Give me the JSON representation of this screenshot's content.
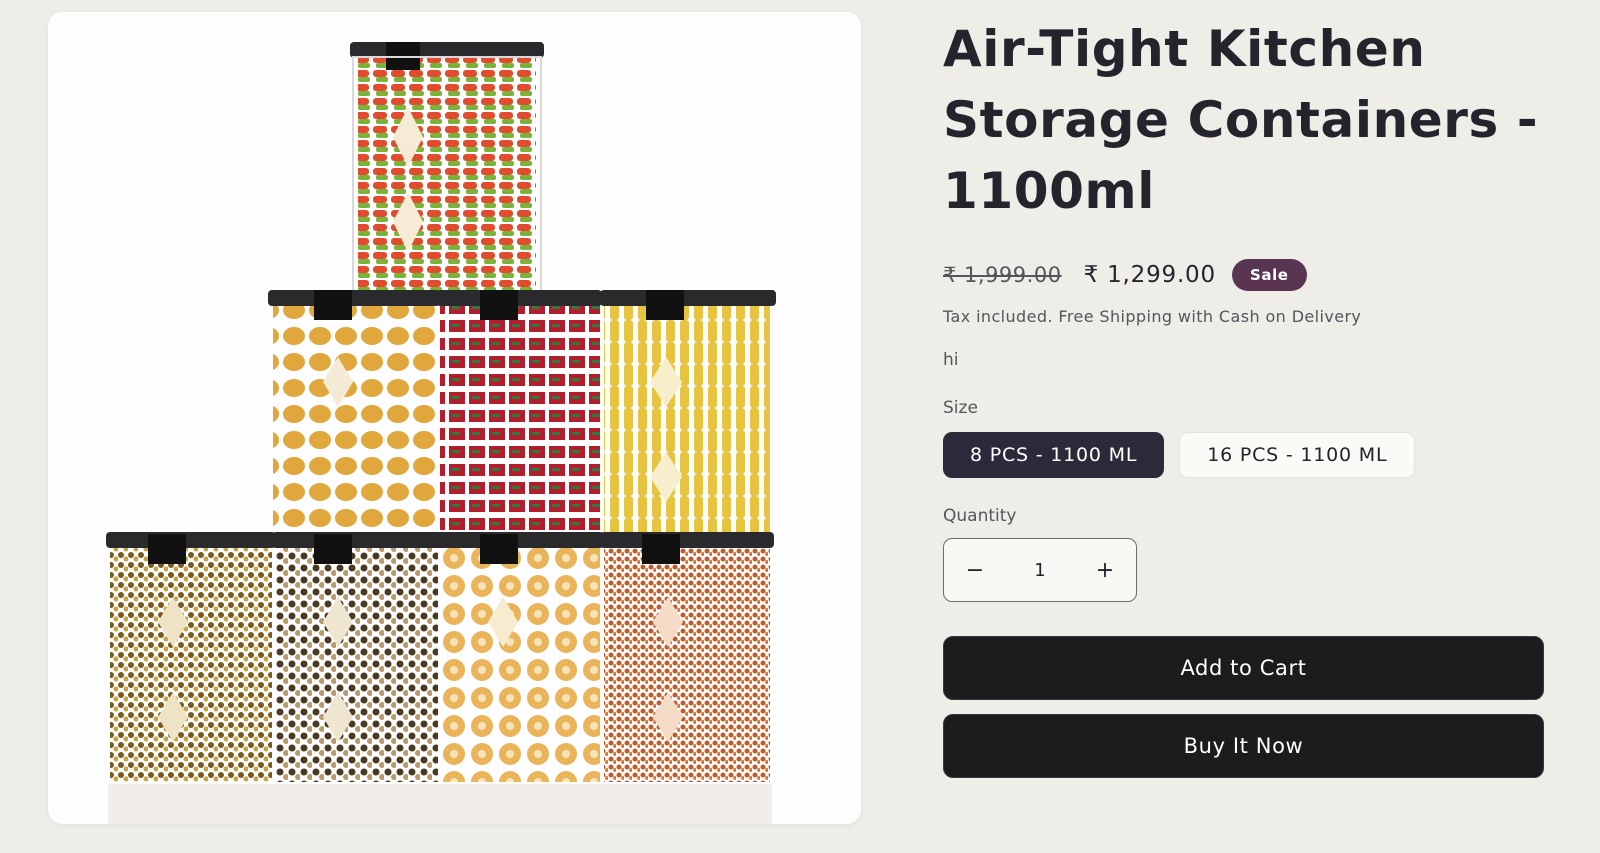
{
  "product": {
    "title": "Air-Tight Kitchen Storage Containers - 1100ml",
    "image_alt": "Stacked air-tight kitchen storage containers filled with pasta, chips, candies and pulses",
    "price_compare": "₹ 1,999.00",
    "price_sale": "₹ 1,299.00",
    "badge": "Sale",
    "tax_note": "Tax included. Free Shipping with Cash on Delivery",
    "description": "hi"
  },
  "variant": {
    "label": "Size",
    "options": [
      "8 PCS - 1100 ML",
      "16 PCS - 1100 ML"
    ],
    "selected": "8 PCS - 1100 ML"
  },
  "quantity": {
    "label": "Quantity",
    "value": "1",
    "decrease_symbol": "−",
    "increase_symbol": "+"
  },
  "actions": {
    "add_to_cart": "Add to Cart",
    "buy_now": "Buy It Now"
  },
  "colors": {
    "background": "#efede8",
    "sale_badge": "#5a3551",
    "selected_variant": "#2a2a3a",
    "button": "#1c1c1f"
  }
}
